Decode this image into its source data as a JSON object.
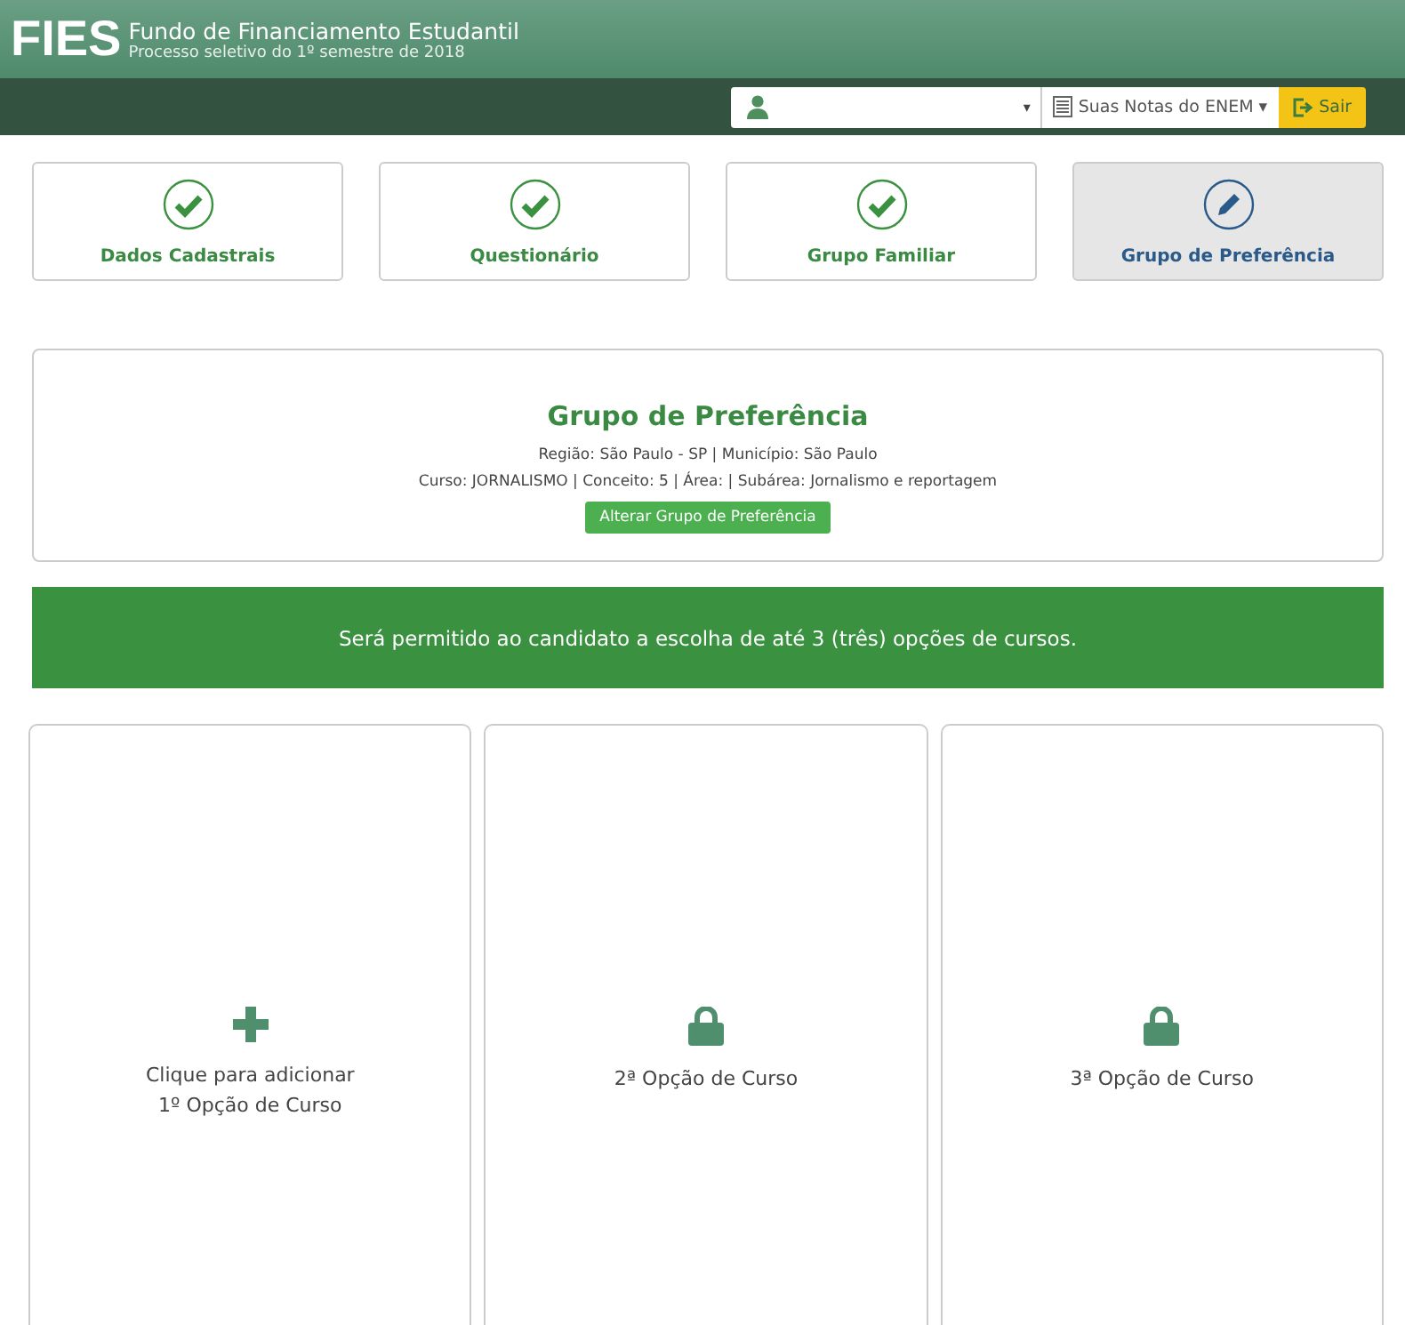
{
  "header": {
    "logo": "FIES",
    "title": "Fundo de Financiamento Estudantil",
    "subtitle": "Processo seletivo do 1º semestre de 2018"
  },
  "toolbar": {
    "user_menu": {
      "caret": "▾"
    },
    "notes_menu": {
      "label": "Suas Notas do ENEM",
      "caret": "▾"
    },
    "logout": {
      "label": "Sair"
    }
  },
  "steps": [
    {
      "label": "Dados Cadastrais",
      "kind": "done",
      "selected": false
    },
    {
      "label": "Questionário",
      "kind": "done",
      "selected": false
    },
    {
      "label": "Grupo Familiar",
      "kind": "done",
      "selected": false
    },
    {
      "label": "Grupo de Preferência",
      "kind": "edit",
      "selected": true
    }
  ],
  "preference": {
    "title": "Grupo de Preferência",
    "lines": [
      "Região: São Paulo - SP | Município: São Paulo",
      "Curso: JORNALISMO | Conceito: 5 | Área: | Subárea: Jornalismo e reportagem"
    ],
    "button": "Alterar Grupo de Preferência"
  },
  "notice": "Será permitido ao candidato a escolha de até 3 (três) opções de cursos.",
  "options": [
    {
      "kind": "add",
      "lines": [
        "Clique para adicionar",
        "1º Opção de Curso"
      ]
    },
    {
      "kind": "locked",
      "lines": [
        "2ª Opção de Curso"
      ]
    },
    {
      "kind": "locked",
      "lines": [
        "3ª Opção de Curso"
      ]
    }
  ]
}
